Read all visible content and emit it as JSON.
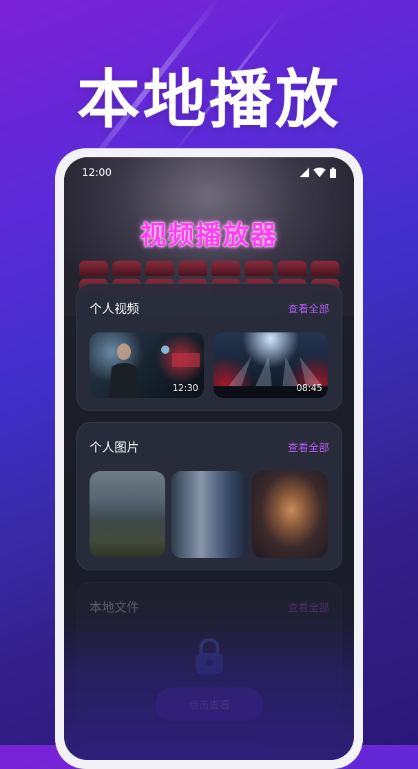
{
  "hero": {
    "title": "本地播放"
  },
  "status_bar": {
    "time": "12:00"
  },
  "app": {
    "title": "视频播放器"
  },
  "videos_section": {
    "title": "个人视频",
    "view_all": "查看全部",
    "items": [
      {
        "duration": "12:30"
      },
      {
        "duration": "08:45"
      }
    ]
  },
  "photos_section": {
    "title": "个人图片",
    "view_all": "查看全部"
  },
  "files_section": {
    "title": "本地文件",
    "view_all": "查看全部",
    "button_label": "点击查看"
  },
  "colors": {
    "accent": "#b95cf7",
    "title_magenta": "#ff3df5",
    "button": "#6a3ae0"
  }
}
